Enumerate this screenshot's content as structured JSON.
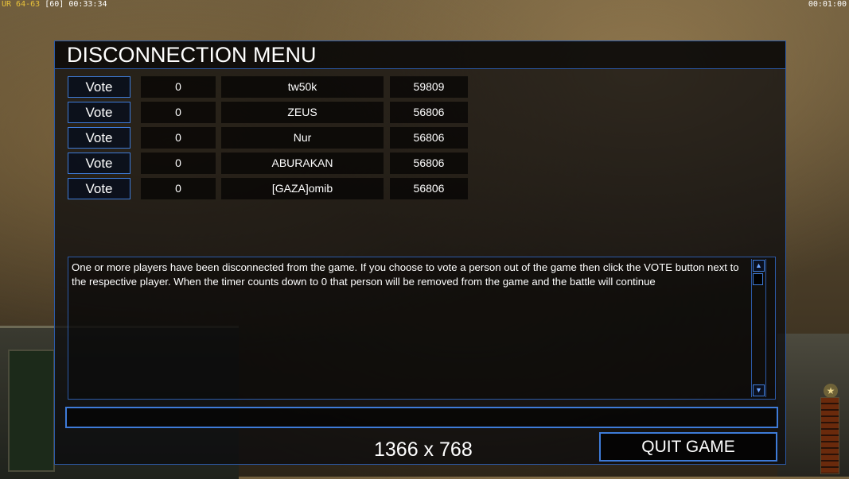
{
  "hud": {
    "top_left_version": "UR 64-63",
    "top_left_fps": "[60]",
    "top_left_time": "00:33:34",
    "top_right_time": "00:01:00"
  },
  "dialog": {
    "title": "DISCONNECTION MENU",
    "vote_label": "Vote",
    "players": [
      {
        "count": "0",
        "name": "tw50k",
        "ping": "59809"
      },
      {
        "count": "0",
        "name": "ZEUS",
        "ping": "56806"
      },
      {
        "count": "0",
        "name": "Nur",
        "ping": "56806"
      },
      {
        "count": "0",
        "name": "ABURAKAN",
        "ping": "56806"
      },
      {
        "count": "0",
        "name": "[GAZA]omib",
        "ping": "56806"
      }
    ],
    "message": "One or more players have been disconnected from the game. If you choose to vote a person out of the game then click the VOTE button next to the respective player. When the timer counts down to 0 that person will be removed from the game and the battle will continue",
    "chat_value": "",
    "resolution": "1366 x 768",
    "quit_label": "QUIT GAME"
  },
  "icons": {
    "scroll_up": "up-arrow-icon",
    "scroll_down": "down-arrow-icon"
  },
  "colors": {
    "accent": "#3e7bd8",
    "version_text": "#e8c23a"
  }
}
